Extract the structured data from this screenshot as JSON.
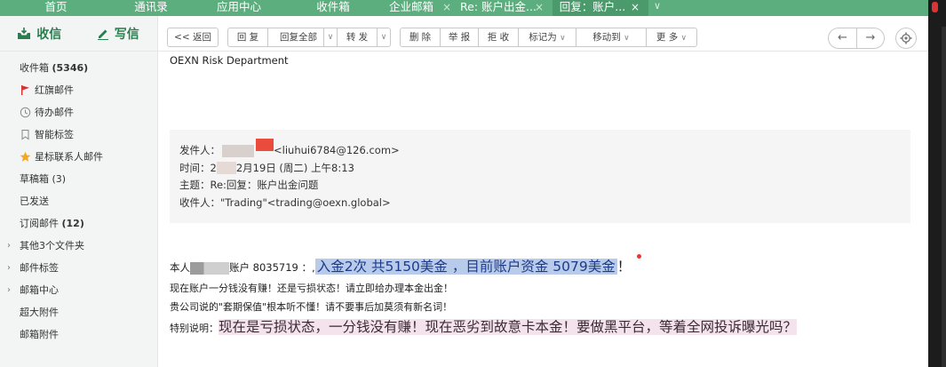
{
  "nav": {
    "tabs": [
      {
        "label": "首页",
        "closable": false
      },
      {
        "label": "通讯录",
        "closable": false
      },
      {
        "label": "应用中心",
        "closable": false
      },
      {
        "label": "收件箱",
        "closable": false
      },
      {
        "label": "企业邮箱",
        "closable": true
      },
      {
        "label": "Re: 账户出金...",
        "closable": true
      },
      {
        "label": "回复：账户...",
        "closable": true,
        "active": true
      }
    ],
    "close_glyph": "×",
    "more_glyph": "∨"
  },
  "sidebar": {
    "receive_label": "收信",
    "compose_label": "写信",
    "folders": [
      {
        "label": "收件箱",
        "count": "(5346)"
      },
      {
        "label": "红旗邮件",
        "icon": "red-flag-icon"
      },
      {
        "label": "待办邮件",
        "icon": "clock-icon"
      },
      {
        "label": "智能标签",
        "icon": "tag-icon"
      },
      {
        "label": "星标联系人邮件",
        "icon": "star-icon"
      },
      {
        "label": "草稿箱 (3)"
      },
      {
        "label": "已发送"
      },
      {
        "label": "订阅邮件",
        "count": "(12)"
      },
      {
        "label": "其他3个文件夹",
        "expandable": true
      },
      {
        "label": "邮件标签",
        "expandable": true
      },
      {
        "label": "邮箱中心",
        "expandable": true
      },
      {
        "label": "超大附件"
      },
      {
        "label": "邮箱附件"
      }
    ]
  },
  "toolbar": {
    "back": "<< 返回",
    "reply": "回 复",
    "reply_all": "回复全部",
    "forward": "转 发",
    "delete": "删 除",
    "report": "举 报",
    "reject": "拒 收",
    "mark_as": "标记为",
    "move_to": "移动到",
    "more": "更 多",
    "dropdown_glyph": "∨",
    "prev_glyph": "←",
    "next_glyph": "→"
  },
  "email": {
    "org_line": "OEXN Risk Department",
    "quote": {
      "from_label": "发件人：",
      "from_email": "<liuhui6784@126.com>",
      "time_label": "时间：",
      "time_value_start": "2",
      "time_value_end": "2月19日 (周二) 上午8:13",
      "subject_label": "主题：",
      "subject_value": "Re:回复：账户出金问题",
      "to_label": "收件人：",
      "to_value": "\"Trading\"<trading@oexn.global>"
    },
    "body": {
      "line1_start": "本人",
      "line1_account": "账户 8035719 ：,",
      "line1_highlight": "入金2次 共5150美金 ，目前账户资金 5079美金",
      "line1_end": "！",
      "line2": "现在账户一分钱没有赚！还是亏损状态！请立即给办理本金出金！",
      "line3": "贵公司说的\"套期保值\"根本听不懂！请不要事后加莫须有新名词！",
      "line4_label": "特别说明：",
      "line4_highlight": "现在是亏损状态，一分钱没有赚！现在恶劣到故意卡本金！要做黑平台，等着全网投诉曝光吗？"
    }
  },
  "colors": {
    "nav_bg": "#5cae7e",
    "nav_active": "#4a9a6c",
    "brand_green": "#2a7d4e",
    "highlight_blue": "#b9cbea",
    "highlight_pink": "#f4e3ec"
  }
}
